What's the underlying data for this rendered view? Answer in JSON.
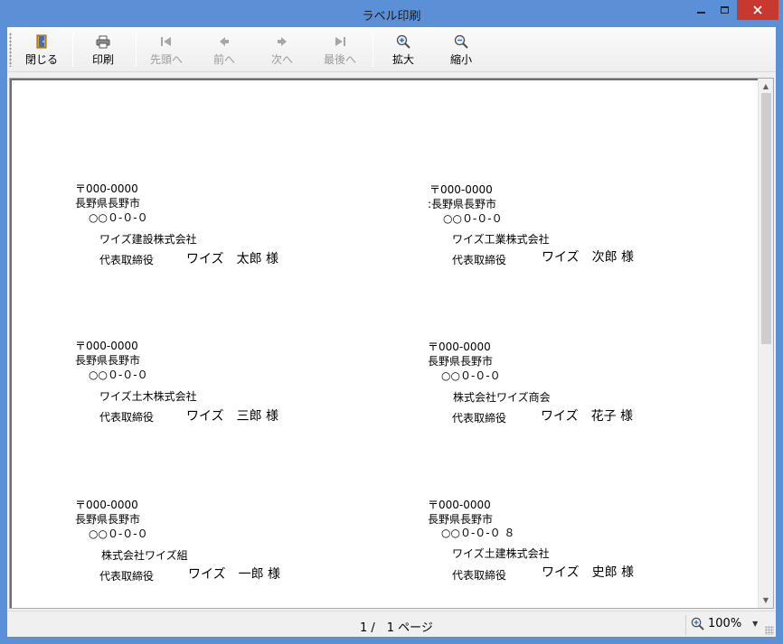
{
  "window": {
    "title": "ラベル印刷"
  },
  "toolbar": {
    "close": "閉じる",
    "print": "印刷",
    "first": "先頭へ",
    "prev": "前へ",
    "next": "次へ",
    "last": "最後へ",
    "zoom_in": "拡大",
    "zoom_out": "縮小"
  },
  "labels": [
    {
      "postal": "〒000-0000",
      "addr1": "長野県長野市",
      "addr2": "○○０-０-０",
      "company": "ワイズ建設株式会社",
      "title": "代表取締役",
      "person": "ワイズ　太郎 様"
    },
    {
      "postal": "〒000-0000",
      "addr1": ":長野県長野市",
      "addr2": "○○０-０-０",
      "company": "ワイズ工業株式会社",
      "title": "代表取締役",
      "person": "ワイズ　次郎 様"
    },
    {
      "postal": "〒000-0000",
      "addr1": "長野県長野市",
      "addr2": "○○０-０-０",
      "company": "ワイズ土木株式会社",
      "title": "代表取締役",
      "person": "ワイズ　三郎 様"
    },
    {
      "postal": "〒000-0000",
      "addr1": "長野県長野市",
      "addr2": "○○０-０-０",
      "company": "株式会社ワイズ商会",
      "title": "代表取締役",
      "person": "ワイズ　花子 様"
    },
    {
      "postal": "〒000-0000",
      "addr1": "長野県長野市",
      "addr2": "○○０-０-０",
      "company": "株式会社ワイズ組",
      "title": "代表取締役",
      "person": "ワイズ　一郎 様"
    },
    {
      "postal": "〒000-0000",
      "addr1": "長野県長野市",
      "addr2": "○○０-０-０ ８",
      "company": "ワイズ土建株式会社",
      "title": "代表取締役",
      "person": "ワイズ　史郎 様"
    }
  ],
  "status": {
    "page_info": "1 /　1 ページ",
    "zoom": "100%"
  }
}
